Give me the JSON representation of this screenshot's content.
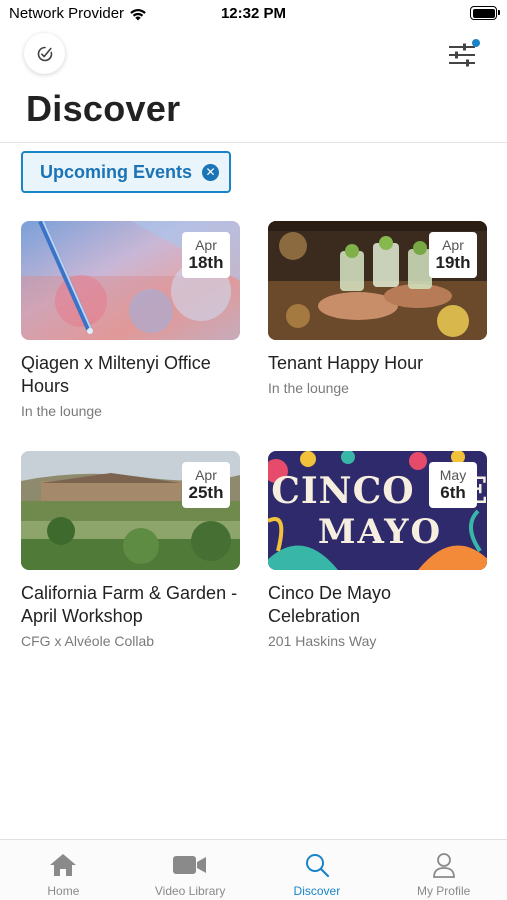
{
  "status_bar": {
    "carrier": "Network Provider",
    "time": "12:32 PM",
    "battery_level": 1.0
  },
  "header": {
    "title": "Discover",
    "left_icon": "check-badge-icon",
    "right_icon": "filter-sliders-icon",
    "filter_indicator_color": "#1a84c8"
  },
  "filter_chip": {
    "label": "Upcoming Events",
    "close_icon": "close-icon"
  },
  "events": [
    {
      "title": "Qiagen x Miltenyi Office Hours",
      "subtitle": "In the lounge",
      "month": "Apr",
      "day": "18th",
      "image": "lab-pipette-photo"
    },
    {
      "title": "Tenant Happy Hour",
      "subtitle": "In the lounge",
      "month": "Apr",
      "day": "19th",
      "image": "cocktail-toast-photo"
    },
    {
      "title": "California Farm & Garden - April Workshop",
      "subtitle": "CFG x Alvéole Collab",
      "month": "Apr",
      "day": "25th",
      "image": "farm-garden-photo"
    },
    {
      "title": "Cinco De Mayo Celebration",
      "subtitle": "201 Haskins Way",
      "month": "May",
      "day": "6th",
      "image": "cinco-de-mayo-banner"
    }
  ],
  "cinco_banner_text": [
    "CINCO DE",
    "MAYO"
  ],
  "tabs": [
    {
      "label": "Home",
      "icon": "home-icon",
      "active": false
    },
    {
      "label": "Video Library",
      "icon": "video-camera-icon",
      "active": false
    },
    {
      "label": "Discover",
      "icon": "search-icon",
      "active": true
    },
    {
      "label": "My Profile",
      "icon": "profile-icon",
      "active": false
    }
  ],
  "colors": {
    "accent": "#1a84c8",
    "inactive_tab": "#8a8a8a"
  }
}
